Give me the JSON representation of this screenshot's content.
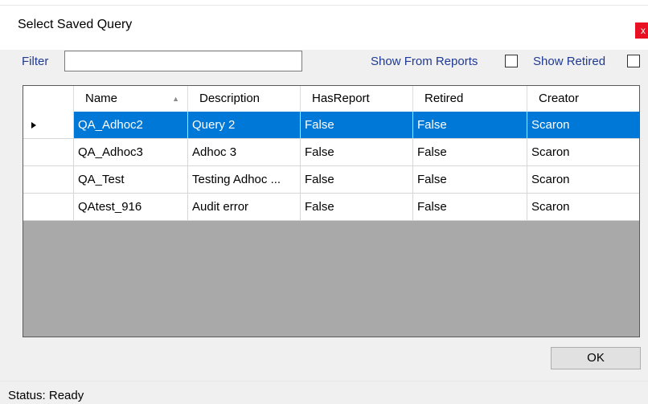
{
  "window": {
    "title": "Select Saved Query",
    "close_label": "x"
  },
  "filter": {
    "label": "Filter",
    "value": ""
  },
  "options": {
    "show_from_reports": {
      "label": "Show From Reports",
      "checked": false
    },
    "show_retired": {
      "label": "Show Retired",
      "checked": false
    }
  },
  "grid": {
    "columns": [
      "Name",
      "Description",
      "HasReport",
      "Retired",
      "Creator"
    ],
    "sort_column": "Name",
    "sort_direction": "ascending",
    "rows": [
      [
        "QA_Adhoc2",
        "Query 2",
        "False",
        "False",
        "Scaron"
      ],
      [
        "QA_Adhoc3",
        "Adhoc 3",
        "False",
        "False",
        "Scaron"
      ],
      [
        "QA_Test",
        "Testing Adhoc ...",
        "False",
        "False",
        "Scaron"
      ],
      [
        "QAtest_916",
        "Audit error",
        "False",
        "False",
        "Scaron"
      ]
    ],
    "selected_row": 0,
    "selection_color": "#0078d7"
  },
  "buttons": {
    "ok_label": "OK"
  },
  "status": {
    "text": "Status: Ready"
  }
}
